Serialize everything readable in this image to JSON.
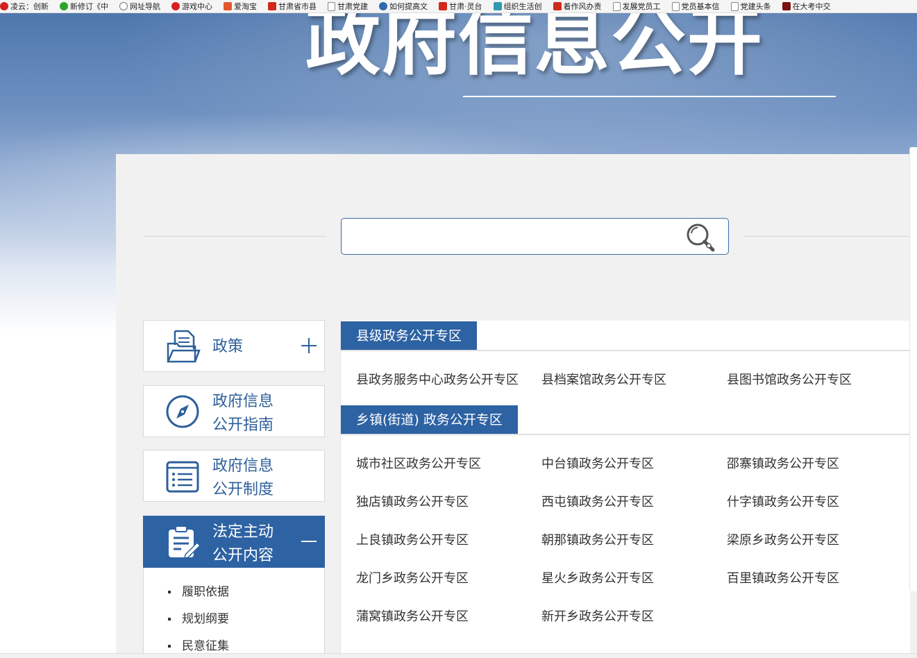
{
  "bookmarks": [
    {
      "label": "凌云：创新",
      "icon": "red-circle-icon"
    },
    {
      "label": "新修订《中",
      "icon": "wechat-icon"
    },
    {
      "label": "网址导航",
      "icon": "globe-icon"
    },
    {
      "label": "游戏中心",
      "icon": "game-icon"
    },
    {
      "label": "爱淘宝",
      "icon": "taobao-icon"
    },
    {
      "label": "甘肃省市县",
      "icon": "emblem-icon"
    },
    {
      "label": "甘肃党建",
      "icon": "page-icon"
    },
    {
      "label": "如何提高文",
      "icon": "paw-icon"
    },
    {
      "label": "甘肃·灵台",
      "icon": "emblem-icon"
    },
    {
      "label": "组织生活创",
      "icon": "document-icon"
    },
    {
      "label": "着作风办责",
      "icon": "emblem-icon"
    },
    {
      "label": "发展党员工",
      "icon": "page-icon"
    },
    {
      "label": "党员基本信",
      "icon": "page-icon"
    },
    {
      "label": "党建头条",
      "icon": "page-icon"
    },
    {
      "label": "在大考中交",
      "icon": "news-icon"
    }
  ],
  "banner": {
    "title": "政府信息公开"
  },
  "search": {
    "value": "",
    "placeholder": ""
  },
  "sidebar": {
    "items": [
      {
        "label_lines": [
          "政策"
        ],
        "icon": "folder-document-icon",
        "toggle": "+"
      },
      {
        "label_lines": [
          "政府信息",
          "公开指南"
        ],
        "icon": "compass-icon"
      },
      {
        "label_lines": [
          "政府信息",
          "公开制度"
        ],
        "icon": "list-document-icon"
      },
      {
        "label_lines": [
          "法定主动",
          "公开内容"
        ],
        "icon": "clipboard-edit-icon",
        "toggle": "—"
      }
    ],
    "sub_items": [
      "履职依据",
      "规划纲要",
      "民意征集"
    ]
  },
  "content": {
    "sections": [
      {
        "title": "县级政务公开专区",
        "links": [
          "县政务服务中心政务公开专区",
          "县档案馆政务公开专区",
          "县图书馆政务公开专区"
        ]
      },
      {
        "title": "乡镇(街道) 政务公开专区",
        "links": [
          "城市社区政务公开专区",
          "中台镇政务公开专区",
          "邵寨镇政务公开专区",
          "独店镇政务公开专区",
          "西屯镇政务公开专区",
          "什字镇政务公开专区",
          "上良镇政务公开专区",
          "朝那镇政务公开专区",
          "梁原乡政务公开专区",
          "龙门乡政务公开专区",
          "星火乡政务公开专区",
          "百里镇政务公开专区",
          "蒲窝镇政务公开专区",
          "新开乡政务公开专区"
        ]
      }
    ]
  },
  "colors": {
    "primary": "#2d62a3",
    "panel_bg": "#f1f1f1",
    "link_text": "#333333"
  }
}
